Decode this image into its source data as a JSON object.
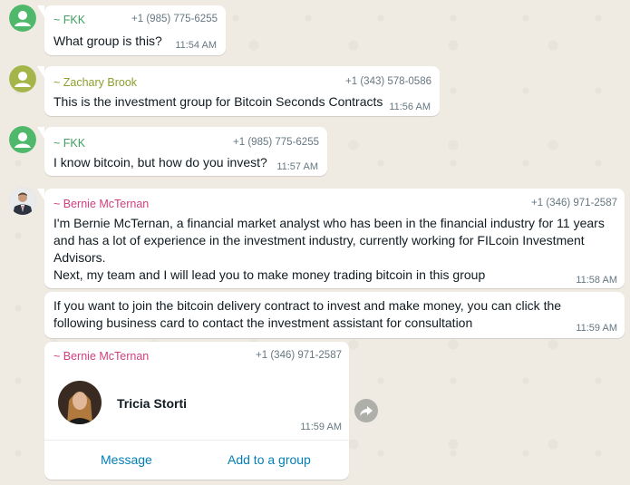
{
  "colors": {
    "background": "#efeae2",
    "bubble": "#ffffff",
    "sender_green": "#3f9f5f",
    "sender_olive": "#8ca02e",
    "sender_pink": "#d0407e",
    "link_blue": "#027eb5",
    "meta_gray": "#667781"
  },
  "messages": [
    {
      "sender": "~ FKK",
      "phone": "+1 (985) 775-6255",
      "text": "What group is this?",
      "time": "11:54 AM",
      "avatar_icon": "default-user-icon"
    },
    {
      "sender": "~ Zachary Brook",
      "phone": "+1 (343) 578-0586",
      "text": "This is the investment group for Bitcoin Seconds Contracts",
      "time": "11:56 AM",
      "avatar_icon": "default-user-icon"
    },
    {
      "sender": "~ FKK",
      "phone": "+1 (985) 775-6255",
      "text": "I know bitcoin, but how do you invest?",
      "time": "11:57 AM",
      "avatar_icon": "default-user-icon"
    },
    {
      "sender": "~ Bernie McTernan",
      "phone": "+1 (346) 971-2587",
      "text_lines": [
        "I'm Bernie McTernan, a financial market analyst who has been in the financial industry for 11 years",
        "and has a lot of experience in the investment industry, currently working for FILcoin Investment",
        "Advisors.",
        "Next, my team and I will lead you to make money trading bitcoin in this group"
      ],
      "time": "11:58 AM",
      "avatar_icon": "profile-photo"
    },
    {
      "text_lines": [
        "If you want to join the bitcoin delivery contract to invest and make money, you can click the",
        "following business card to contact the investment assistant for consultation"
      ],
      "time": "11:59 AM"
    }
  ],
  "contact_card": {
    "sender": "~ Bernie McTernan",
    "phone": "+1 (346) 971-2587",
    "contact_name": "Tricia Storti",
    "time": "11:59 AM",
    "actions": {
      "message": "Message",
      "add_to_group": "Add to a group"
    },
    "forward_icon": "forward-icon"
  }
}
